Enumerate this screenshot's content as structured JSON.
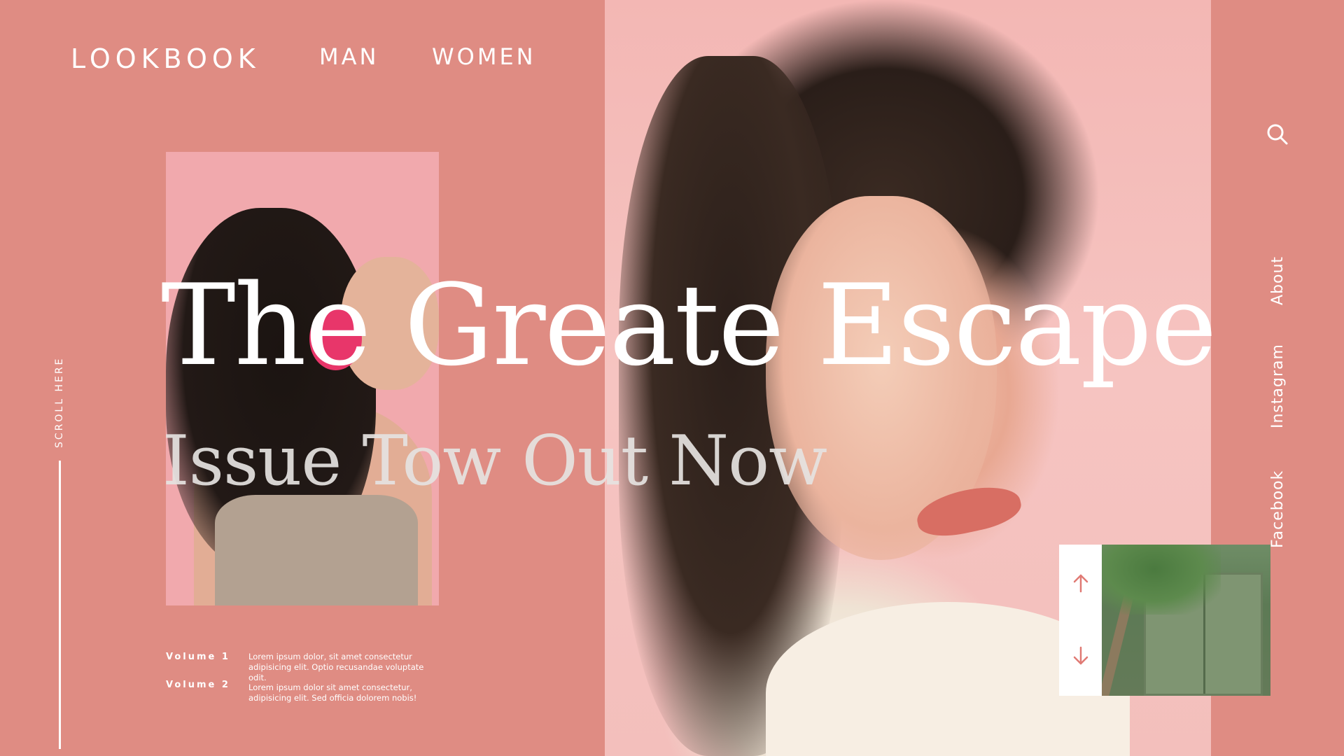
{
  "header": {
    "logo": "LOOKBOOK",
    "nav": [
      {
        "label": "MAN"
      },
      {
        "label": "WOMEN"
      }
    ]
  },
  "hero": {
    "title": "The Greate Escape",
    "subtitle": "Issue Tow Out Now"
  },
  "scroll": {
    "label": "SCROLL HERE"
  },
  "volumes": [
    {
      "label": "Volume 1",
      "text": "Lorem ipsum dolor, sit amet consectetur adipisicing elit. Optio recusandae voluptate odit."
    },
    {
      "label": "Volume 2",
      "text": "Lorem ipsum dolor sit amet consectetur, adipisicing elit. Sed officia dolorem nobis!"
    }
  ],
  "sidebar": {
    "links": [
      {
        "label": "About"
      },
      {
        "label": "Instagram"
      },
      {
        "label": "Facebook"
      }
    ]
  },
  "theme": {
    "background": "#df8c83",
    "accent": "#e07a74",
    "text": "#ffffff"
  }
}
